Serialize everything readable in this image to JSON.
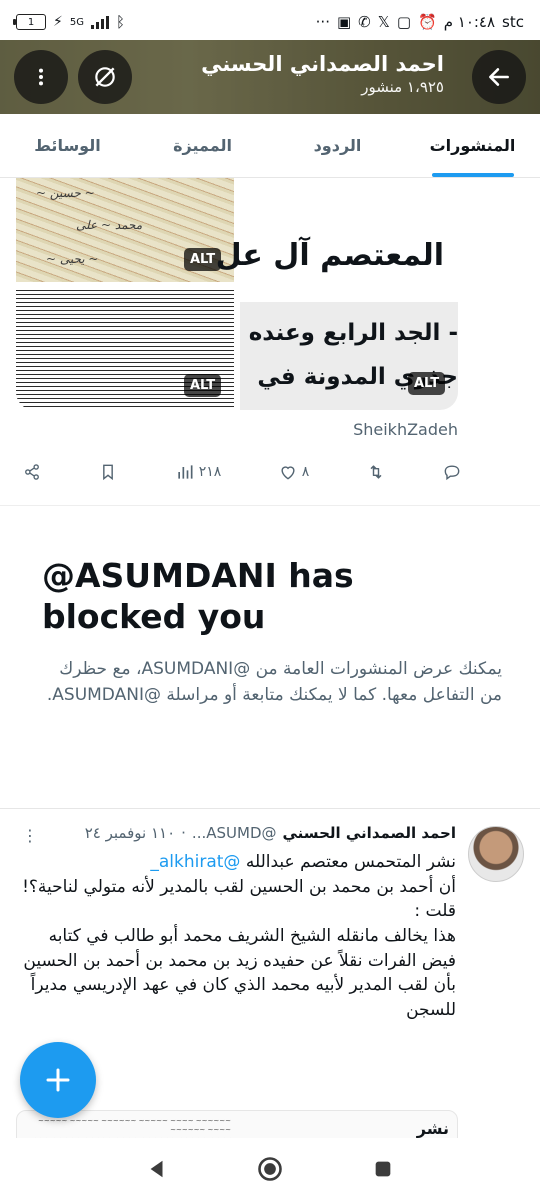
{
  "status_bar": {
    "carrier": "stc",
    "time": "١٠:٤٨ م",
    "battery": "1",
    "network": "5G"
  },
  "header": {
    "name": "احمد الصمداني الحسني",
    "posts_count": "١،٩٢٥ منشور",
    "back_icon": "arrow-left-icon",
    "more_icon": "more-vertical-icon",
    "grok_icon": "grok-icon"
  },
  "tabs": [
    {
      "label": "المنشورات",
      "active": true
    },
    {
      "label": "الردود",
      "active": false
    },
    {
      "label": "المميزة",
      "active": false
    },
    {
      "label": "الوسائط",
      "active": false
    }
  ],
  "media_post": {
    "alt_badge": "ALT",
    "image_text_line1": "المعتصم آل عل",
    "image_text_line2": "- الجد الرابع وعنده",
    "image_text_line3": "جذري المدونة في",
    "source": "SheikhZadeh",
    "views": "٢١٨",
    "likes": "٨"
  },
  "blocked": {
    "heading": "@ASUMDANI has blocked you",
    "message": "يمكنك عرض المنشورات العامة من @ASUMDANI، مع حظرك من التفاعل معها. كما لا يمكنك متابعة أو مراسلة @ASUMDANI."
  },
  "tweet": {
    "name": "احمد الصمداني الحسني",
    "handle": "@ASUMD...",
    "date": "١١٠ نوفمبر ٢٤",
    "line1_prefix": "نشر المتحمس معتصم عبدالله",
    "mention": "@alkhirat_",
    "line2": "أن أحمد بن محمد بن الحسين لقب بالمدير لأنه متولي لناحية؟!",
    "line3": "قلت :",
    "line4": "هذا يخالف مانقله الشيخ الشريف محمد أبو طالب في كتابه فيض الفرات نقلاً عن حفيده زيد بن محمد بن أحمد بن الحسين بأن لقب المدير لأبيه محمد الذي كان في عهد الإدريسي مديراً للسجن",
    "quote_preview_right": "نشر"
  },
  "fab": {
    "icon": "plus-icon"
  },
  "colors": {
    "accent": "#1d9bf0",
    "text": "#0f1419",
    "muted": "#536471"
  }
}
